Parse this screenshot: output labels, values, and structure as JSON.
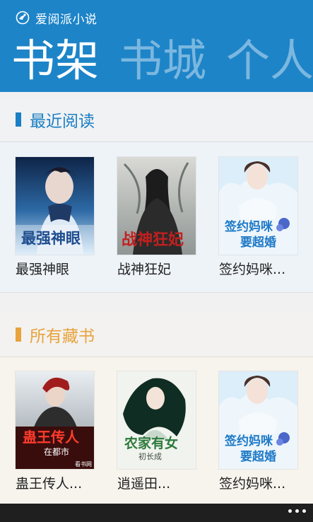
{
  "app": {
    "title": "爱阅派小说"
  },
  "pivot": {
    "items": [
      {
        "label": "书架",
        "active": true
      },
      {
        "label": "书城",
        "active": false
      },
      {
        "label": "个人",
        "active": false
      }
    ]
  },
  "recent": {
    "title": "最近阅读",
    "accent": "#1a7fc4",
    "books": [
      {
        "title": "最强神眼",
        "cover_text": "最强神眼"
      },
      {
        "title": "战神狂妃",
        "cover_text": "战神狂妃"
      },
      {
        "title": "签约妈咪...",
        "cover_text": "签约妈咪要超婚"
      }
    ]
  },
  "collection": {
    "title": "所有藏书",
    "accent": "#e8a33c",
    "books": [
      {
        "title": "蛊王传人...",
        "cover_text": "蛊王传人",
        "cover_subtext": "在都市"
      },
      {
        "title": "逍遥田...",
        "cover_text": "农家有女",
        "cover_subtext": "初长成"
      },
      {
        "title": "签约妈咪...",
        "cover_text": "签约妈咪要超婚"
      }
    ]
  },
  "colors": {
    "header_bg": "#1d84c8",
    "appbar_bg": "#1f1f1f"
  },
  "appbar": {
    "more_icon": "more-dots-icon"
  }
}
